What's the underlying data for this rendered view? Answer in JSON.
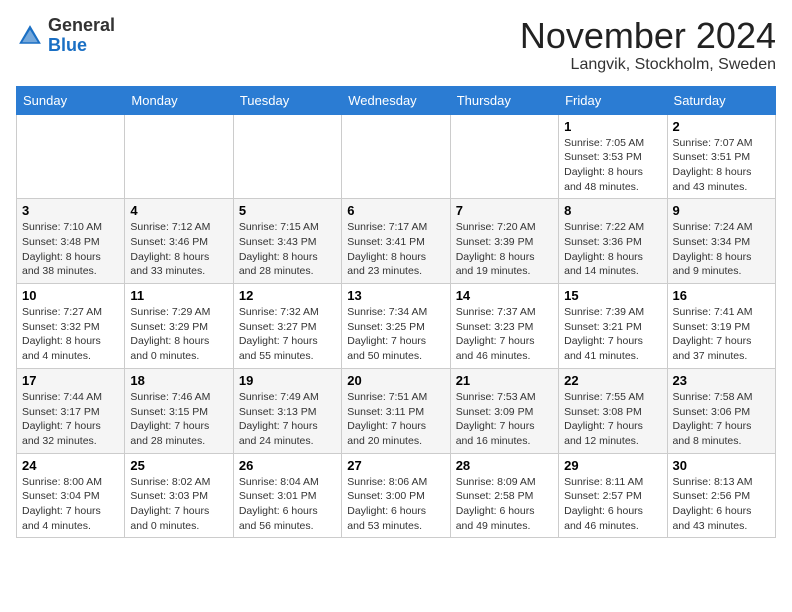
{
  "header": {
    "logo_general": "General",
    "logo_blue": "Blue",
    "month_title": "November 2024",
    "location": "Langvik, Stockholm, Sweden"
  },
  "days_of_week": [
    "Sunday",
    "Monday",
    "Tuesday",
    "Wednesday",
    "Thursday",
    "Friday",
    "Saturday"
  ],
  "weeks": [
    [
      {
        "day": "",
        "detail": ""
      },
      {
        "day": "",
        "detail": ""
      },
      {
        "day": "",
        "detail": ""
      },
      {
        "day": "",
        "detail": ""
      },
      {
        "day": "",
        "detail": ""
      },
      {
        "day": "1",
        "detail": "Sunrise: 7:05 AM\nSunset: 3:53 PM\nDaylight: 8 hours and 48 minutes."
      },
      {
        "day": "2",
        "detail": "Sunrise: 7:07 AM\nSunset: 3:51 PM\nDaylight: 8 hours and 43 minutes."
      }
    ],
    [
      {
        "day": "3",
        "detail": "Sunrise: 7:10 AM\nSunset: 3:48 PM\nDaylight: 8 hours and 38 minutes."
      },
      {
        "day": "4",
        "detail": "Sunrise: 7:12 AM\nSunset: 3:46 PM\nDaylight: 8 hours and 33 minutes."
      },
      {
        "day": "5",
        "detail": "Sunrise: 7:15 AM\nSunset: 3:43 PM\nDaylight: 8 hours and 28 minutes."
      },
      {
        "day": "6",
        "detail": "Sunrise: 7:17 AM\nSunset: 3:41 PM\nDaylight: 8 hours and 23 minutes."
      },
      {
        "day": "7",
        "detail": "Sunrise: 7:20 AM\nSunset: 3:39 PM\nDaylight: 8 hours and 19 minutes."
      },
      {
        "day": "8",
        "detail": "Sunrise: 7:22 AM\nSunset: 3:36 PM\nDaylight: 8 hours and 14 minutes."
      },
      {
        "day": "9",
        "detail": "Sunrise: 7:24 AM\nSunset: 3:34 PM\nDaylight: 8 hours and 9 minutes."
      }
    ],
    [
      {
        "day": "10",
        "detail": "Sunrise: 7:27 AM\nSunset: 3:32 PM\nDaylight: 8 hours and 4 minutes."
      },
      {
        "day": "11",
        "detail": "Sunrise: 7:29 AM\nSunset: 3:29 PM\nDaylight: 8 hours and 0 minutes."
      },
      {
        "day": "12",
        "detail": "Sunrise: 7:32 AM\nSunset: 3:27 PM\nDaylight: 7 hours and 55 minutes."
      },
      {
        "day": "13",
        "detail": "Sunrise: 7:34 AM\nSunset: 3:25 PM\nDaylight: 7 hours and 50 minutes."
      },
      {
        "day": "14",
        "detail": "Sunrise: 7:37 AM\nSunset: 3:23 PM\nDaylight: 7 hours and 46 minutes."
      },
      {
        "day": "15",
        "detail": "Sunrise: 7:39 AM\nSunset: 3:21 PM\nDaylight: 7 hours and 41 minutes."
      },
      {
        "day": "16",
        "detail": "Sunrise: 7:41 AM\nSunset: 3:19 PM\nDaylight: 7 hours and 37 minutes."
      }
    ],
    [
      {
        "day": "17",
        "detail": "Sunrise: 7:44 AM\nSunset: 3:17 PM\nDaylight: 7 hours and 32 minutes."
      },
      {
        "day": "18",
        "detail": "Sunrise: 7:46 AM\nSunset: 3:15 PM\nDaylight: 7 hours and 28 minutes."
      },
      {
        "day": "19",
        "detail": "Sunrise: 7:49 AM\nSunset: 3:13 PM\nDaylight: 7 hours and 24 minutes."
      },
      {
        "day": "20",
        "detail": "Sunrise: 7:51 AM\nSunset: 3:11 PM\nDaylight: 7 hours and 20 minutes."
      },
      {
        "day": "21",
        "detail": "Sunrise: 7:53 AM\nSunset: 3:09 PM\nDaylight: 7 hours and 16 minutes."
      },
      {
        "day": "22",
        "detail": "Sunrise: 7:55 AM\nSunset: 3:08 PM\nDaylight: 7 hours and 12 minutes."
      },
      {
        "day": "23",
        "detail": "Sunrise: 7:58 AM\nSunset: 3:06 PM\nDaylight: 7 hours and 8 minutes."
      }
    ],
    [
      {
        "day": "24",
        "detail": "Sunrise: 8:00 AM\nSunset: 3:04 PM\nDaylight: 7 hours and 4 minutes."
      },
      {
        "day": "25",
        "detail": "Sunrise: 8:02 AM\nSunset: 3:03 PM\nDaylight: 7 hours and 0 minutes."
      },
      {
        "day": "26",
        "detail": "Sunrise: 8:04 AM\nSunset: 3:01 PM\nDaylight: 6 hours and 56 minutes."
      },
      {
        "day": "27",
        "detail": "Sunrise: 8:06 AM\nSunset: 3:00 PM\nDaylight: 6 hours and 53 minutes."
      },
      {
        "day": "28",
        "detail": "Sunrise: 8:09 AM\nSunset: 2:58 PM\nDaylight: 6 hours and 49 minutes."
      },
      {
        "day": "29",
        "detail": "Sunrise: 8:11 AM\nSunset: 2:57 PM\nDaylight: 6 hours and 46 minutes."
      },
      {
        "day": "30",
        "detail": "Sunrise: 8:13 AM\nSunset: 2:56 PM\nDaylight: 6 hours and 43 minutes."
      }
    ]
  ]
}
